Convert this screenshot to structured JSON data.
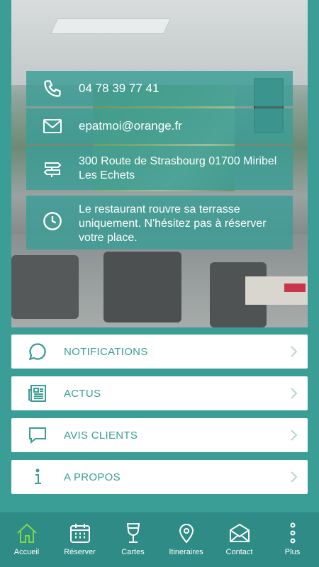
{
  "contact": {
    "phone": "04 78 39 77 41",
    "email": "epatmoi@orange.fr",
    "address": "300 Route de Strasbourg 01700 Miribel Les Echets",
    "notice": "Le restaurant rouvre sa terrasse uniquement. N'hésitez pas à réserver votre place."
  },
  "menu": {
    "items": [
      {
        "label": "NOTIFICATIONS",
        "icon": "chat-bubble-icon"
      },
      {
        "label": "ACTUS",
        "icon": "newspaper-icon"
      },
      {
        "label": "AVIS CLIENTS",
        "icon": "comment-icon"
      },
      {
        "label": "A PROPOS",
        "icon": "info-icon"
      }
    ]
  },
  "tabbar": {
    "tabs": [
      {
        "label": "Accueil",
        "icon": "home-icon",
        "active": true
      },
      {
        "label": "Réserver",
        "icon": "calendar-icon",
        "active": false
      },
      {
        "label": "Cartes",
        "icon": "wine-glass-icon",
        "active": false
      },
      {
        "label": "Itineraires",
        "icon": "map-pin-icon",
        "active": false
      },
      {
        "label": "Contact",
        "icon": "envelope-icon",
        "active": false
      },
      {
        "label": "Plus",
        "icon": "more-dots-icon",
        "active": false
      }
    ]
  },
  "colors": {
    "brand": "#3a9d96",
    "tabbar": "#2f8b85",
    "active_tab": "#7dd84a"
  }
}
